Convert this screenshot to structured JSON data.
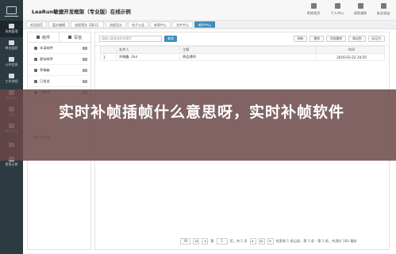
{
  "sidebar": {
    "items": [
      {
        "label": "系统管理",
        "icon": "monitor-icon"
      },
      {
        "label": "单位组织",
        "icon": "org-icon"
      },
      {
        "label": "公共信息",
        "icon": "globe-icon"
      },
      {
        "label": "工作流程",
        "icon": "flow-icon"
      },
      {
        "label": "报表中心",
        "icon": "chart-icon"
      },
      {
        "label": "流程",
        "icon": "list-icon"
      },
      {
        "label": "客户关系",
        "icon": "users-icon"
      },
      {
        "label": "",
        "icon": "grid-icon"
      },
      {
        "label": "常用示例",
        "icon": "sample-icon"
      }
    ]
  },
  "header": {
    "title": "LeaRun敏捷开发框架（专业版）在线示例",
    "buttons": [
      {
        "label": "系统首页",
        "icon": "home-icon"
      },
      {
        "label": "个人中心",
        "icon": "user-icon"
      },
      {
        "label": "消息通知",
        "icon": "bell-icon"
      },
      {
        "label": "安全退出",
        "icon": "power-icon"
      }
    ]
  },
  "tabs": [
    "欢迎首页",
    "富文编辑",
    "流程预览【演示】",
    "流程设计",
    "电子公告",
    "新闻中心",
    "文件中心",
    "邮件中心"
  ],
  "mailbox": {
    "compose_label": "收件",
    "write_label": "写信",
    "folders": [
      {
        "label": "未读邮件",
        "count": "0",
        "icon": "mail-icon"
      },
      {
        "label": "星标邮件",
        "count": "0",
        "icon": "star-icon"
      },
      {
        "label": "草稿箱",
        "count": "0",
        "icon": "draft-icon"
      },
      {
        "label": "已发送",
        "count": "0",
        "icon": "send-icon"
      },
      {
        "label": "已删除",
        "count": "0",
        "icon": "trash-icon"
      }
    ],
    "footer": "我的文件夹"
  },
  "toolbar": {
    "search_placeholder": "请输入要查询的关键字",
    "search_label": "查询",
    "buttons": [
      "刷新",
      "删除",
      "彻底删除",
      "移动到",
      "标记为"
    ]
  },
  "table": {
    "headers": [
      "",
      "发件人",
      "主题",
      "时间"
    ],
    "rows": [
      {
        "index": "1",
        "sender": "刘晓鑫（liu）",
        "subject": "周会通知",
        "time": "2016-03-22 20:20"
      }
    ]
  },
  "pager": {
    "page_size": "30",
    "page_prefix": "第",
    "current_page": "1",
    "page_suffix": "页，共 1 页",
    "summary": "检索到 1 条记录，第 1 条 - 第 1 条，共用时 104 毫秒"
  },
  "banner": {
    "text": "实时补帧插帧什么意思呀，实时补帧软件"
  },
  "colors": {
    "sidebar_bg": "#2c3b41",
    "accent": "#3c8dbc",
    "banner_overlay": "#6c4848"
  }
}
